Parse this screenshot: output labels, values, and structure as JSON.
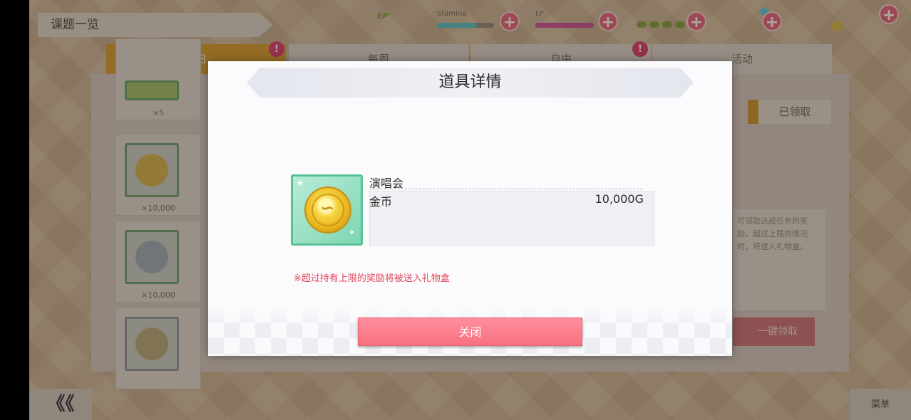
{
  "background": {
    "breadcrumb": "课题一览",
    "tabs": [
      {
        "label": "每日",
        "alert": "!"
      },
      {
        "label": "每周",
        "alert": ""
      },
      {
        "label": "自由",
        "alert": "!"
      },
      {
        "label": "活动",
        "alert": ""
      }
    ],
    "rewards": [
      {
        "qty": "×5"
      },
      {
        "qty": "×10,000"
      },
      {
        "qty": "×10,000"
      },
      {
        "qty": ""
      }
    ],
    "claimed_button": "已领取",
    "info_text": "可领取达成任务的奖励。超过上限的情况时，将送入礼物盒。",
    "claim_all_button": "一键领取",
    "back_button": "《《",
    "menu_button": "菜单",
    "stats": {
      "stamina_label": "Stamina",
      "lp_label": "LP",
      "ep_label": "EP"
    }
  },
  "modal": {
    "title": "道具详情",
    "item": {
      "category": "演唱会",
      "name": "金币",
      "amount": "10,000G",
      "icon": "gold-coin-icon"
    },
    "warning": "※超过持有上限的奖励将被送入礼物盒",
    "close_button": "关闭"
  },
  "colors": {
    "accent_pink": "#f7717f",
    "warning_red": "#e0465b",
    "item_frame_green": "#56c296",
    "tab_active": "#d59a2a"
  }
}
